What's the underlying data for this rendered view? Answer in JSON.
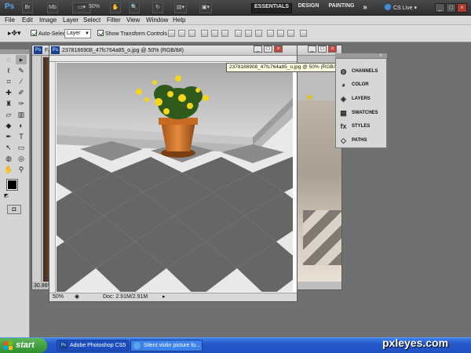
{
  "app": {
    "logo": "Ps",
    "zoom": "50%",
    "workspaces": [
      "ESSENTIALS",
      "DESIGN",
      "PAINTING"
    ],
    "more": "»",
    "cs_live": "CS Live",
    "window_buttons": [
      "_",
      "□",
      "×"
    ]
  },
  "menu": [
    "File",
    "Edit",
    "Image",
    "Layer",
    "Select",
    "Filter",
    "View",
    "Window",
    "Help"
  ],
  "options": {
    "auto_select_label": "Auto-Select:",
    "auto_select_value": "Layer",
    "transform_label": "Show Transform Controls"
  },
  "documents": {
    "back_title": "Fa",
    "front_title": "2378166908_47fc764a85_o.jpg @ 50% (RGB/8#)",
    "front_zoom": "50%",
    "front_doc": "Doc: 2.91M/2.91M",
    "back_zoom": "30.86%"
  },
  "tooltip": "2378166908_47fc764a85_o.jpg @ 50% (RGB/8#)",
  "panels": [
    "CHANNELS",
    "COLOR",
    "LAYERS",
    "SWATCHES",
    "STYLES",
    "PATHS"
  ],
  "taskbar": {
    "start": "start",
    "tasks": [
      "Adobe Photoshop CS5",
      "Silent violin picture fo..."
    ]
  },
  "watermark": "pxleyes.com"
}
